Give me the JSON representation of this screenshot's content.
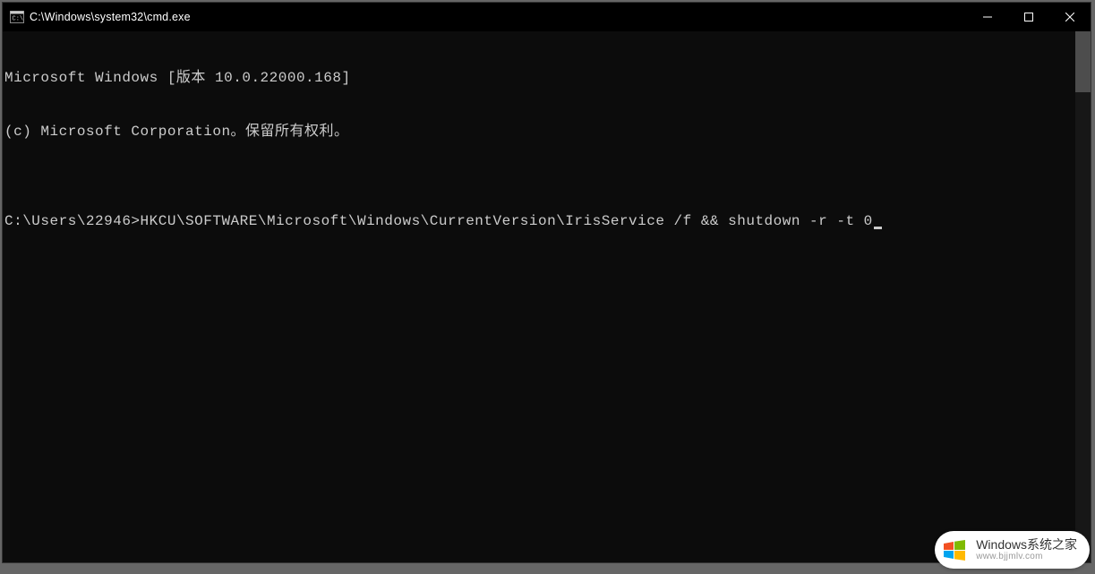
{
  "window": {
    "title": "C:\\Windows\\system32\\cmd.exe"
  },
  "terminal": {
    "line1": "Microsoft Windows [版本 10.0.22000.168]",
    "line2": "(c) Microsoft Corporation。保留所有权利。",
    "line3": "",
    "prompt": "C:\\Users\\22946>",
    "command": "HKCU\\SOFTWARE\\Microsoft\\Windows\\CurrentVersion\\IrisService /f && shutdown -r -t 0"
  },
  "watermark": {
    "brand": "Windows",
    "brand_cn": "系统之家",
    "url": "www.bjjmlv.com"
  }
}
